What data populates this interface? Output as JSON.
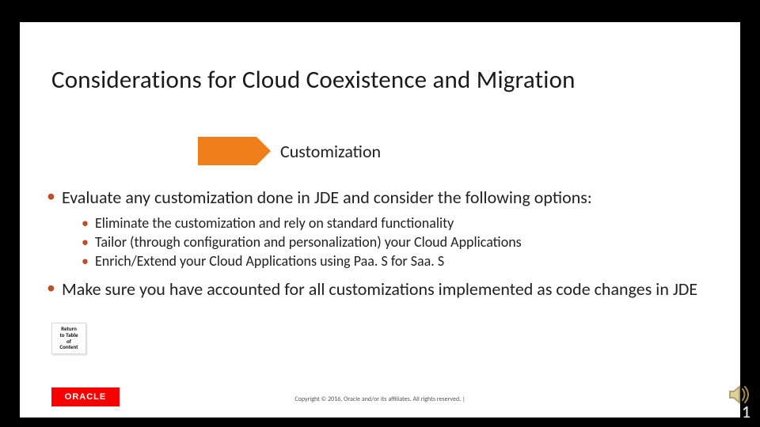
{
  "title": "Considerations for Cloud Coexistence and Migration",
  "badge": {
    "label": "Customization"
  },
  "bullets": {
    "main1": "Evaluate any customization done in JDE and consider the following options:",
    "sub1": "Eliminate the customization and rely on standard functionality",
    "sub2": "Tailor (through configuration and personalization) your Cloud Applications",
    "sub3": "Enrich/Extend your Cloud Applications using Paa. S for Saa. S",
    "main2": "Make sure you have accounted for all customizations implemented as code changes in JDE"
  },
  "return_button": {
    "line1": "Return",
    "line2": "to Table",
    "line3": "of",
    "line4": "Content"
  },
  "footer": {
    "logo_text": "ORACLE",
    "copyright": "Copyright © 2016, Oracle and/or its affiliates. All rights reserved.  |",
    "page_number": "1"
  },
  "colors": {
    "accent": "#ee7f1b",
    "bullet": "#b8512a",
    "oracle_red": "#f80000"
  }
}
